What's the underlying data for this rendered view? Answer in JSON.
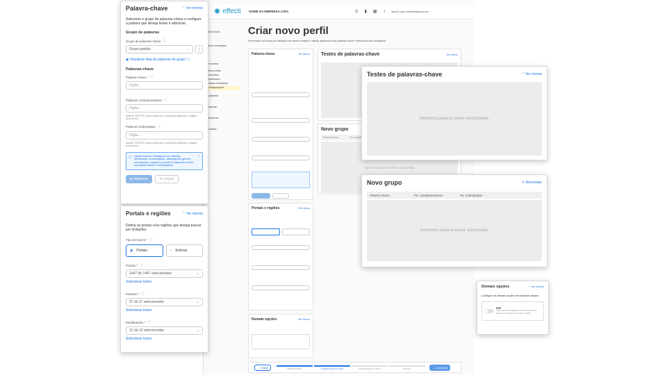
{
  "topbar": {
    "logo": "effecti",
    "company": "NOME DA EMPRESA LTDA",
    "user_email": "layout+copy+reviewer@gmail.com"
  },
  "sidebar": {
    "items": [
      "Tela inicial",
      "Meus resultados",
      "Encontrar",
      "Meus perfis",
      "Pesquisar",
      "Dashboard",
      "Pastas completas",
      "Configurações",
      "Cadastrar",
      "Disputar",
      "Monitorar",
      "Analisar"
    ]
  },
  "main": {
    "title": "Criar novo perfil",
    "subtitle": "Personalize sua busca por licitações de maneira simples e rápida, ajustando suas palavras-chave e otimizando seus resultados.",
    "tests_title": "Testes de palavras-chave",
    "tests_empty": "Nenhuma palavra-chave selecionada.",
    "group_title": "Novo grupo",
    "group_empty": "Nenhuma palavra-chave adicionada",
    "col_kw": "Palavra-chave",
    "col_comp": "Pa. complementares",
    "col_indes": "Pa. indesejadas",
    "back": "Voltar",
    "next": "Continuar",
    "steps": [
      "Palavras-chave",
      "Configurações de busca",
      "Configurações de envio",
      "Resumo"
    ]
  },
  "keyword_panel": {
    "title": "Palavra-chave",
    "toggle": "Ver menos",
    "desc": "Selecione o grupo de palavras-chave e configure a palavra que deseja testar e adicionar.",
    "group_heading": "Grupo de palavras",
    "group_label": "Grupo de palavras-chave",
    "group_value": "Grupo padrão",
    "view_list": "Visualizar lista de palavras do grupo",
    "kw_heading": "Palavras-chave",
    "kw_label": "Palavra-chave *",
    "kw_placeholder": "Digite...",
    "comp_label": "Palavras complementares",
    "comp_placeholder": "Digite...",
    "comp_hint": "Aperte 'ENTER' para adicionar a palavra digitada e digitar uma nova.",
    "indes_label": "Palavras indesejadas",
    "indes_placeholder": "Digite...",
    "indes_hint": "Aperte 'ENTER' para adicionar a palavra digitada e digitar uma nova.",
    "info": "Nossa busca é inteligente por padrão, otimizando os resultados, abrangendo gênero, acentuação, singular e plural de palavras-chave, complementares e indesejadas.",
    "add": "Adicionar",
    "clear": "Limpar"
  },
  "portals_panel": {
    "title": "Portais e regiões",
    "toggle": "Ver menos",
    "desc": "Defina os portais e/ou regiões que deseja buscar por licitações.",
    "type_label": "Tipo de busca *",
    "opt1": "Portais",
    "opt2": "Esferas",
    "portals_label": "Portais *",
    "portals_value": "1447 de 1447 selecionados",
    "select_all": "Selecionar todos",
    "states_label": "Estados *",
    "states_value": "27 de 27 selecionados",
    "mod_label": "Modalidades *",
    "mod_value": "12 de 12 selecionadas"
  },
  "tests_panel": {
    "title": "Testes de palavras-chave",
    "toggle": "Ver menos",
    "empty": "Nenhuma palavra-chave selecionada."
  },
  "group_panel": {
    "title": "Novo grupo",
    "rename": "Renomear",
    "col1": "Palavra-chave",
    "col2": "Pa. complementares",
    "col3": "Pa. indesejadas",
    "empty": "Nenhuma palavra-chave adicionada."
  },
  "other_panel": {
    "title": "Demais opções",
    "toggle": "Ver menos",
    "desc": "Configure as demais opções de licitações abaixo.",
    "switch_label": "SRP",
    "switch_desc": "Incluir apenas unidades que fazem parte do Sistema de Registro de Preços (SRP)."
  },
  "colors": {
    "accent": "#1a73e8",
    "brand": "#2196c9"
  }
}
